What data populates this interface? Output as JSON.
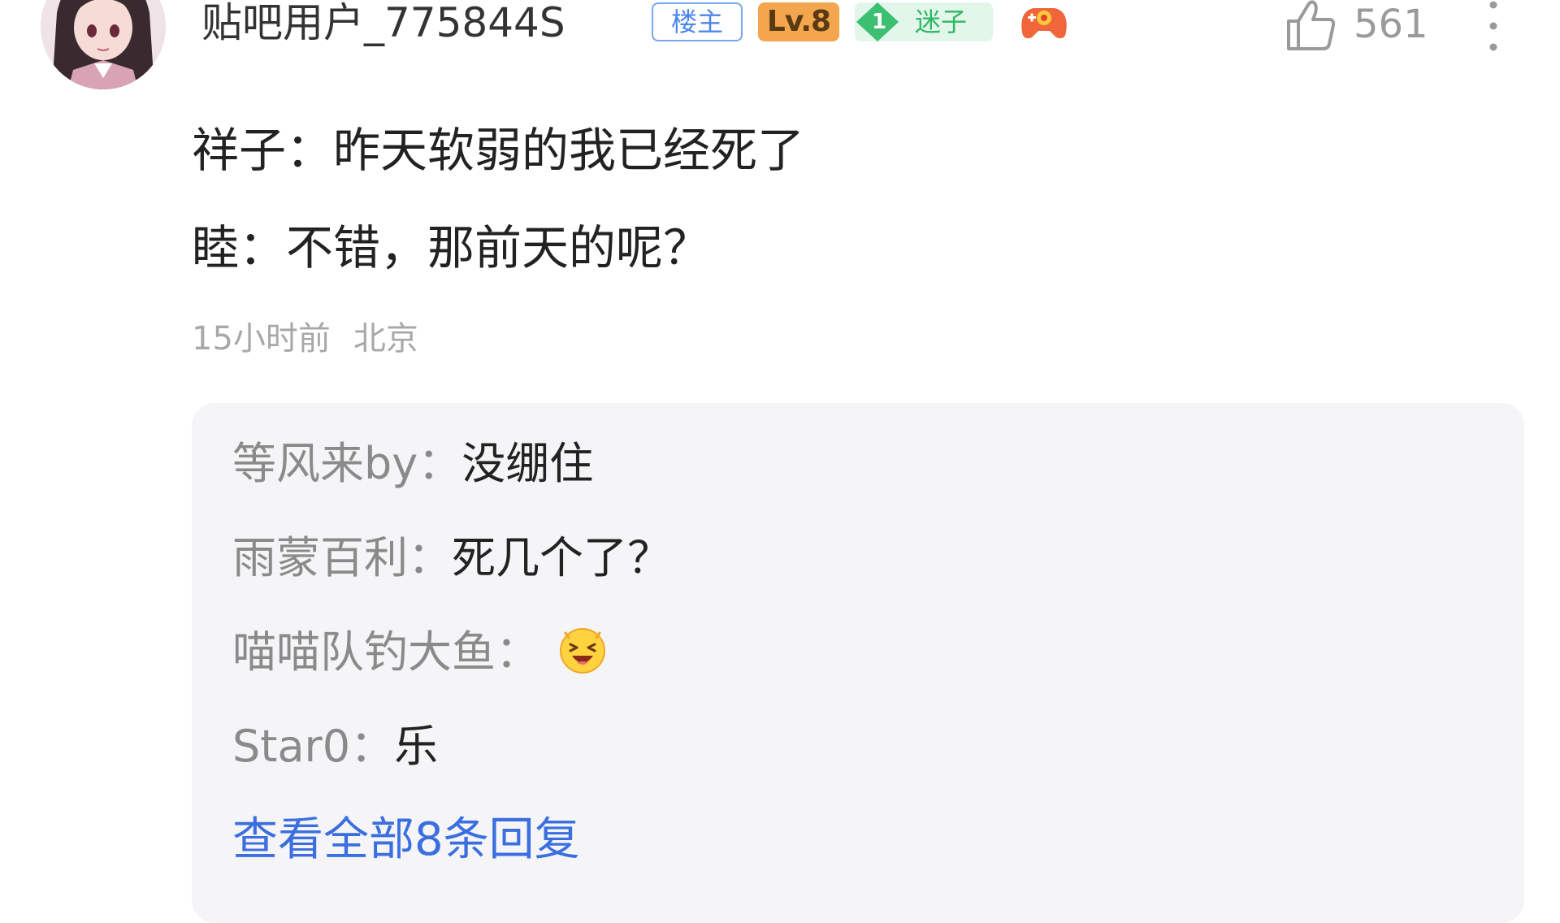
{
  "post": {
    "author": {
      "name": "贴吧用户_775844S",
      "owner_badge": "楼主",
      "level_badge": "Lv.8",
      "fan_level": "1",
      "fan_label": "迷子",
      "avatar_icon": "anime-girl-avatar",
      "game_badge_icon": "game-controller-icon"
    },
    "likes": "561",
    "content": {
      "line1": "祥子：昨天软弱的我已经死了",
      "line2": "睦：不错，那前天的呢？"
    },
    "time": "15小时前",
    "location": "北京"
  },
  "replies": {
    "items": [
      {
        "name": "等风来by",
        "sep": "：",
        "text": "没绷住"
      },
      {
        "name": "雨蒙百利",
        "sep": "：",
        "text": "死几个了？"
      },
      {
        "name": "喵喵队钓大鱼",
        "sep": "：",
        "text": "",
        "emoji": "laughing-emoji"
      },
      {
        "name": "Star0",
        "sep": "：",
        "text": "乐"
      }
    ],
    "view_all": "查看全部8条回复"
  },
  "colors": {
    "accent_blue": "#3b6fe0",
    "level_orange": "#f3a64e",
    "fan_green": "#2fb866",
    "reply_bg": "#f5f5f7"
  }
}
